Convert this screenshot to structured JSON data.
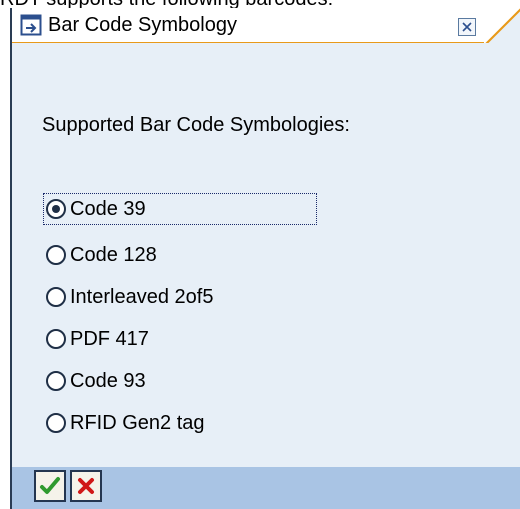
{
  "page_caption": "RDT supports the following barcodes:",
  "dialog": {
    "title": "Bar Code Symbology",
    "title_icon": "dialog-arrow-icon",
    "close_icon": "close-icon",
    "heading": "Supported Bar Code Symbologies:",
    "options": [
      {
        "label": "Code 39",
        "selected": true
      },
      {
        "label": "Code 128",
        "selected": false
      },
      {
        "label": "Interleaved 2of5",
        "selected": false
      },
      {
        "label": "PDF 417",
        "selected": false
      },
      {
        "label": "Code 93",
        "selected": false
      },
      {
        "label": "RFID Gen2 tag",
        "selected": false
      }
    ],
    "footer": {
      "confirm_icon": "checkmark-icon",
      "cancel_icon": "cancel-x-icon"
    }
  },
  "colors": {
    "dialog_background": "#e7eff7",
    "footer_background": "#a9c4e4",
    "title_accent": "#e89a1a",
    "confirm_green": "#2f9a2f",
    "cancel_red": "#d01818"
  }
}
